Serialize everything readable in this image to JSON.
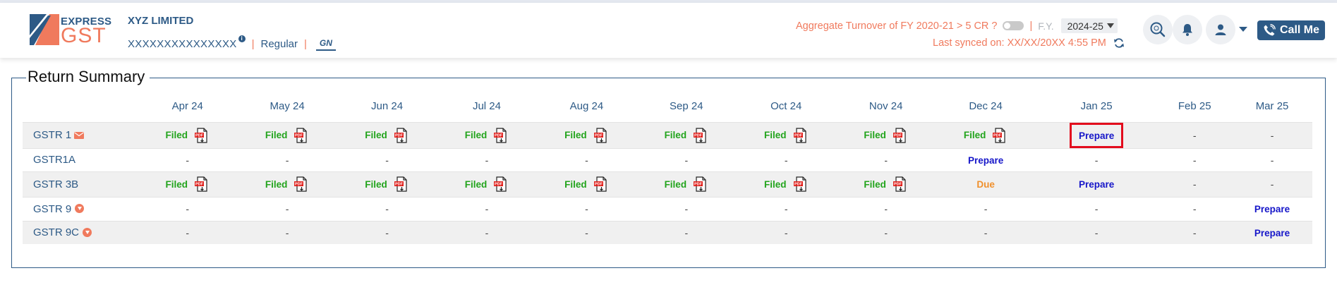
{
  "brand": {
    "express": "EXPRESS",
    "gst": "GST"
  },
  "company": {
    "name": "XYZ LIMITED",
    "gstin": "XXXXXXXXXXXXXXX",
    "info": "i",
    "type": "Regular",
    "badge": "GN",
    "separator": "|"
  },
  "topbar": {
    "aggregate_text": "Aggregate Turnover of FY 2020-21 > 5 CR ?",
    "fy_label": "F.Y.",
    "fy_value": "2024-25",
    "synced_text": "Last synced on: XX/XX/20XX 4:55 PM",
    "call_label": "Call Me"
  },
  "colors": {
    "brand_blue": "#2d5a86",
    "accent_orange": "#f07a5d",
    "filed_green": "#22a41c",
    "prepare_blue": "#1616c9",
    "due_orange": "#f0902c",
    "highlight_red": "#e30c1d"
  },
  "summary": {
    "title": "Return Summary",
    "months": [
      "Apr 24",
      "May 24",
      "Jun 24",
      "Jul 24",
      "Aug 24",
      "Sep 24",
      "Oct 24",
      "Nov 24",
      "Dec 24",
      "Jan 25",
      "Feb 25",
      "Mar 25"
    ],
    "rows": [
      {
        "name": "GSTR 1",
        "icon": "mail-icon",
        "cells": [
          "Filed",
          "Filed",
          "Filed",
          "Filed",
          "Filed",
          "Filed",
          "Filed",
          "Filed",
          "Filed",
          "Prepare",
          "-",
          "-"
        ]
      },
      {
        "name": "GSTR1A",
        "icon": "",
        "cells": [
          "-",
          "-",
          "-",
          "-",
          "-",
          "-",
          "-",
          "-",
          "Prepare",
          "-",
          "-",
          "-"
        ]
      },
      {
        "name": "GSTR 3B",
        "icon": "",
        "cells": [
          "Filed",
          "Filed",
          "Filed",
          "Filed",
          "Filed",
          "Filed",
          "Filed",
          "Filed",
          "Due",
          "Prepare",
          "-",
          "-"
        ]
      },
      {
        "name": "GSTR 9",
        "icon": "download-icon",
        "cells": [
          "-",
          "-",
          "-",
          "-",
          "-",
          "-",
          "-",
          "-",
          "-",
          "-",
          "-",
          "Prepare"
        ]
      },
      {
        "name": "GSTR 9C",
        "icon": "download-icon",
        "cells": [
          "-",
          "-",
          "-",
          "-",
          "-",
          "-",
          "-",
          "-",
          "-",
          "-",
          "-",
          "Prepare"
        ]
      }
    ],
    "pdf_icon_text": "PDF"
  }
}
